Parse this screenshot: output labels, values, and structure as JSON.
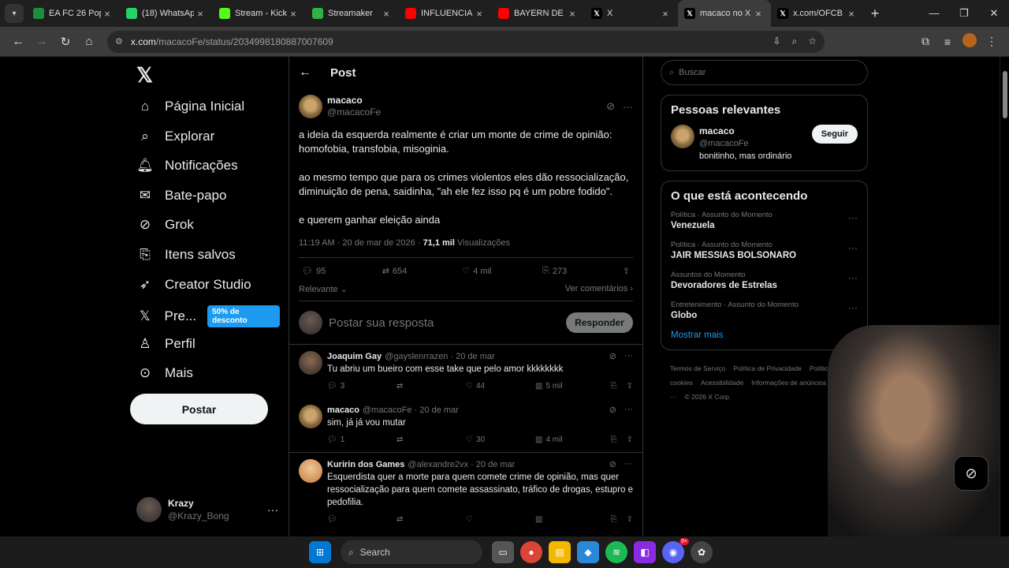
{
  "browser": {
    "tabs": [
      {
        "title": "EA FC 26 Pop",
        "icon_color": "#1e8e3e"
      },
      {
        "title": "(18) WhatsAp",
        "icon_color": "#25d366"
      },
      {
        "title": "Stream - Kick",
        "icon_color": "#53fc18"
      },
      {
        "title": "Streamaker",
        "icon_color": "#2fb344"
      },
      {
        "title": "INFLUENCIAD",
        "icon_color": "#ff0000"
      },
      {
        "title": "BAYERN DE M",
        "icon_color": "#ff0000"
      },
      {
        "title": "X",
        "icon_color": "#000000"
      },
      {
        "title": "macaco no X",
        "icon_color": "#000000",
        "active": true
      },
      {
        "title": "x.com/OFCB",
        "icon_color": "#000000"
      }
    ],
    "url_host": "x.com",
    "url_path": "/macacoFe/status/2034998180887007609"
  },
  "nav": {
    "items": [
      {
        "label": "Página Inicial",
        "icon": "home-icon"
      },
      {
        "label": "Explorar",
        "icon": "search-icon"
      },
      {
        "label": "Notificações",
        "icon": "bell-icon"
      },
      {
        "label": "Bate-papo",
        "icon": "mail-icon"
      },
      {
        "label": "Grok",
        "icon": "grok-icon"
      },
      {
        "label": "Itens salvos",
        "icon": "bookmark-icon"
      },
      {
        "label": "Creator Studio",
        "icon": "rocket-icon"
      },
      {
        "label": "Pre...",
        "icon": "x-logo-icon"
      },
      {
        "label": "Perfil",
        "icon": "person-icon"
      },
      {
        "label": "Mais",
        "icon": "more-circle-icon"
      }
    ],
    "premium_badge": "50% de desconto",
    "post_button": "Postar",
    "account": {
      "name": "Krazy",
      "handle": "@Krazy_Bong"
    }
  },
  "main": {
    "header_title": "Post",
    "post": {
      "name": "macaco",
      "handle": "@macacoFe",
      "paragraphs": [
        "a ideia da esquerda realmente é criar um monte de crime de opinião: homofobia, transfobia, misoginia.",
        "ao mesmo tempo que para os crimes violentos eles dão ressocialização, diminuição de pena, saidinha, \"ah ele fez isso pq é um pobre fodido\".",
        "e querem ganhar eleição ainda"
      ],
      "time": "11:19 AM · 20 de mar de 2026 ·",
      "views_count": "71,1 mil",
      "views_label": "Visualizações",
      "replies": "95",
      "reposts": "654",
      "likes": "4 mil",
      "bookmarks": "273"
    },
    "sort_label": "Relevante",
    "view_comments": "Ver comentários",
    "reply_placeholder": "Postar sua resposta",
    "reply_button": "Responder",
    "replies": [
      {
        "name": "Joaquim Gay",
        "handle": "@gayslenrrazen",
        "date": "· 20 de mar",
        "text": "Tu abriu um bueiro com esse take que pelo amor kkkkkkkk",
        "replies": "3",
        "reposts": "",
        "likes": "44",
        "views": "5 mil",
        "avatar": "person"
      },
      {
        "name": "macaco",
        "handle": "@macacoFe",
        "date": "· 20 de mar",
        "text": "sim, já já vou mutar",
        "replies": "1",
        "reposts": "",
        "likes": "30",
        "views": "4 mil",
        "avatar": "monkey"
      },
      {
        "name": "Kuririn dos Games",
        "handle": "@alexandre2vx",
        "date": "· 20 de mar",
        "text": "Esquerdista quer a morte para quem comete crime de opinião, mas quer ressocialização para quem comete assassinato, tráfico de drogas, estupro e pedofilia.",
        "replies": "",
        "reposts": "",
        "likes": "",
        "views": "",
        "avatar": "kuririn"
      }
    ]
  },
  "sidebar": {
    "search_placeholder": "Buscar",
    "relevant_title": "Pessoas relevantes",
    "relevant_person": {
      "name": "macaco",
      "handle": "@macacoFe",
      "bio": "bonitinho, mas ordinário",
      "follow": "Seguir"
    },
    "trending_title": "O que está acontecendo",
    "trends": [
      {
        "category": "Política · Assunto do Momento",
        "name": "Venezuela"
      },
      {
        "category": "Política · Assunto do Momento",
        "name": "JAIR MESSIAS BOLSONARO"
      },
      {
        "category": "Assuntos do Momento",
        "name": "Devoradores de Estrelas"
      },
      {
        "category": "Entretenimento · Assunto do Momento",
        "name": "Globo"
      }
    ],
    "show_more": "Mostrar mais",
    "footer_links": [
      "Termos de Serviço",
      "Política de Privacidade",
      "Política de cookies",
      "Acessibilidade",
      "Informações de anúncios",
      "Mais ···",
      "© 2026 X Corp."
    ]
  },
  "taskbar": {
    "search_label": "Search",
    "badge": "9+"
  }
}
